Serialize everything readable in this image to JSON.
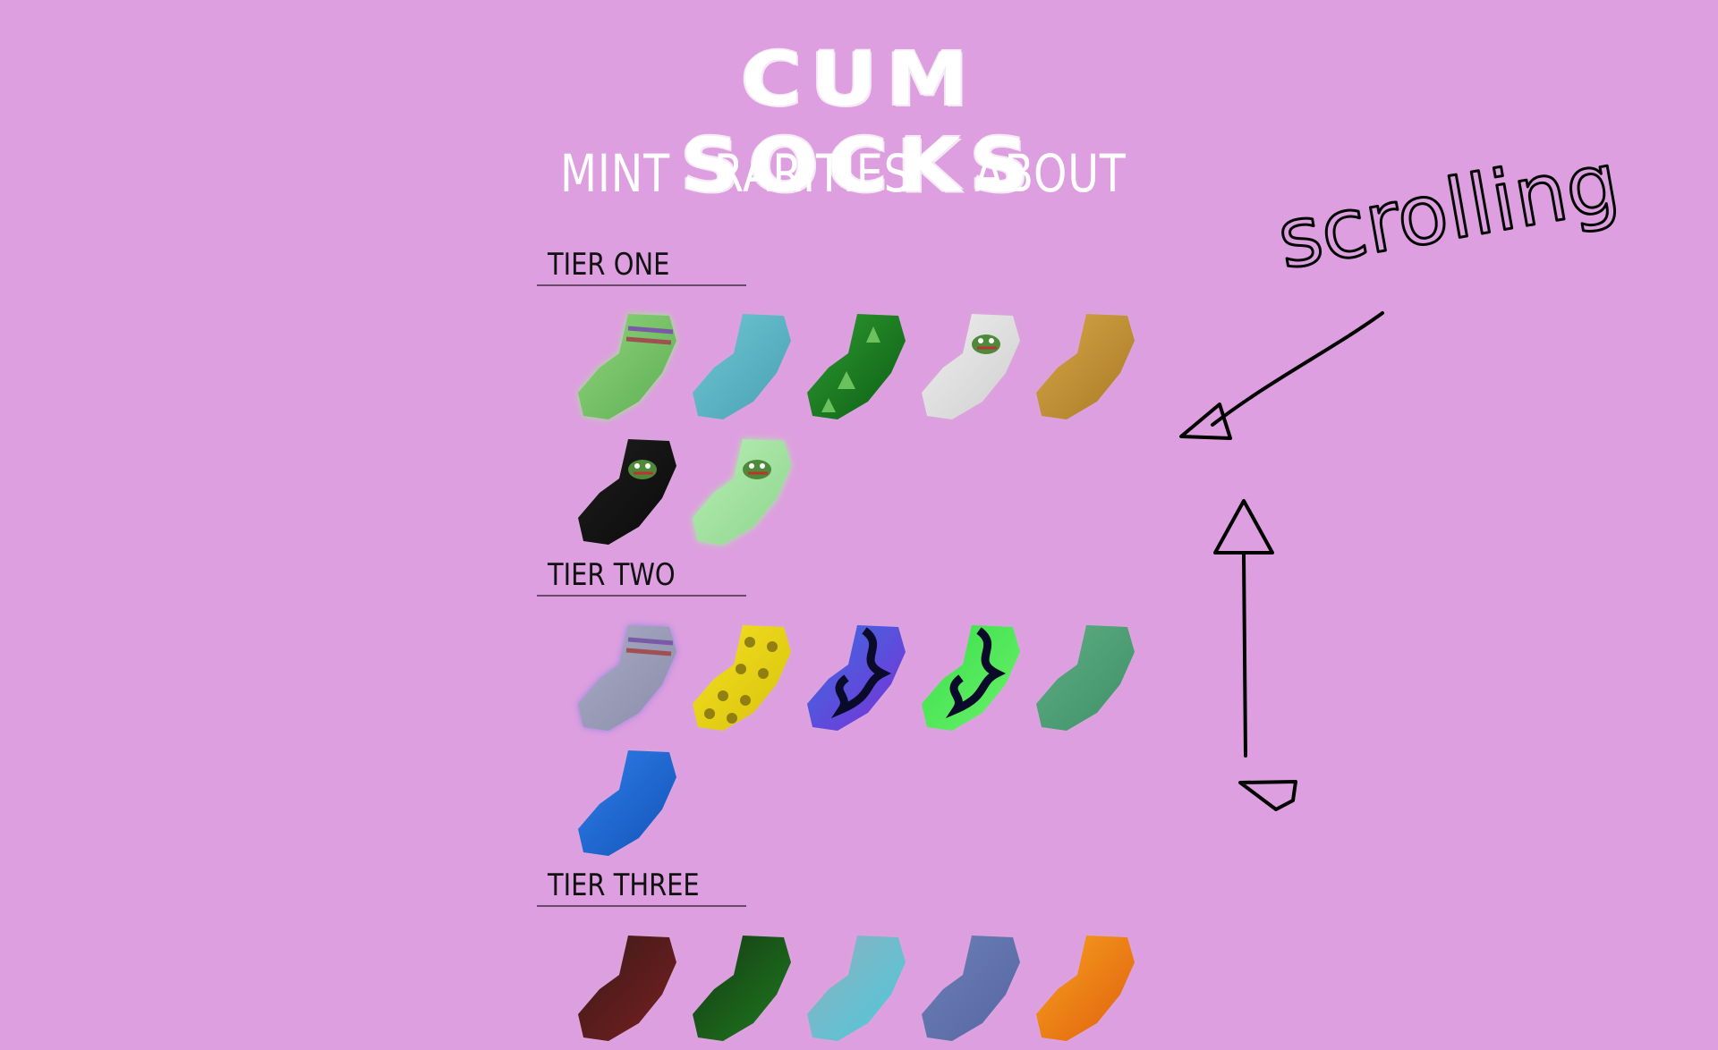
{
  "brand": {
    "logo_text": "CUM SOCKS"
  },
  "nav": {
    "items": [
      "MINT",
      "RARITIES",
      "ABOUT"
    ]
  },
  "tiers": [
    {
      "label": "TIER ONE",
      "socks": [
        {
          "icon": "green-striped-sock-icon",
          "colors": [
            "#8fd47a",
            "#5fae55"
          ],
          "glow": "#9df28c",
          "stripe": true
        },
        {
          "icon": "cyan-sparkle-sock-icon",
          "colors": [
            "#6fc6d2",
            "#4aa0b3"
          ],
          "glow": "#d9a7de"
        },
        {
          "icon": "leaf-pattern-sock-icon",
          "colors": [
            "#2f9a33",
            "#0b5e12"
          ],
          "glow": "#d9a7de",
          "pattern": "leaf"
        },
        {
          "icon": "white-frog-sock-icon",
          "colors": [
            "#eeeeee",
            "#cfcfcf"
          ],
          "glow": "#d9a7de",
          "frog": true
        },
        {
          "icon": "gold-sparkle-sock-icon",
          "colors": [
            "#d6a648",
            "#a97a25"
          ],
          "glow": "#d9a7de"
        },
        {
          "icon": "black-frog-sock-icon",
          "colors": [
            "#1e1e1e",
            "#0a0a0a"
          ],
          "glow": "#d9a7de",
          "frog": true
        },
        {
          "icon": "mint-frog-sock-icon",
          "colors": [
            "#b7efb5",
            "#8ed48d"
          ],
          "glow": "#a8f5a2",
          "frog": true
        }
      ]
    },
    {
      "label": "TIER TWO",
      "socks": [
        {
          "icon": "grey-striped-sock-icon",
          "colors": [
            "#a9acc4",
            "#8a8caa"
          ],
          "glow": "#8f86e0",
          "stripe": true
        },
        {
          "icon": "yellow-spotted-sock-icon",
          "colors": [
            "#f5e022",
            "#d8c20c"
          ],
          "glow": "#d9a7de",
          "pattern": "spots"
        },
        {
          "icon": "purple-flame-sock-icon",
          "colors": [
            "#3a6fe0",
            "#7b2fd8"
          ],
          "glow": "#d9a7de",
          "pattern": "flame"
        },
        {
          "icon": "green-flame-sock-icon",
          "colors": [
            "#39e04a",
            "#6bf06b"
          ],
          "glow": "#d9a7de",
          "pattern": "flame"
        },
        {
          "icon": "jade-sparkle-sock-icon",
          "colors": [
            "#5fae83",
            "#3f8f68"
          ],
          "glow": "#d9a7de"
        },
        {
          "icon": "blue-crystal-sock-icon",
          "colors": [
            "#2f7ee8",
            "#1253b8"
          ],
          "glow": "#d9a7de"
        }
      ]
    },
    {
      "label": "TIER THREE",
      "socks": [
        {
          "icon": "dark-red-sock-icon",
          "colors": [
            "#3a1a1a",
            "#7a1f1f"
          ],
          "glow": "#d9a7de"
        },
        {
          "icon": "dark-leaf-sock-icon",
          "colors": [
            "#143a14",
            "#1f7a1f"
          ],
          "glow": "#d9a7de"
        },
        {
          "icon": "teal-striped-sock-icon",
          "colors": [
            "#8fb0c2",
            "#4dc9d8"
          ],
          "glow": "#d9a7de"
        },
        {
          "icon": "slate-blue-sock-icon",
          "colors": [
            "#6d7fb8",
            "#5566a0"
          ],
          "glow": "#d9a7de"
        },
        {
          "icon": "orange-crystal-sock-icon",
          "colors": [
            "#f7a020",
            "#e0600c"
          ],
          "glow": "#d9a7de"
        }
      ]
    }
  ],
  "annotation": {
    "text": "scrolling"
  }
}
